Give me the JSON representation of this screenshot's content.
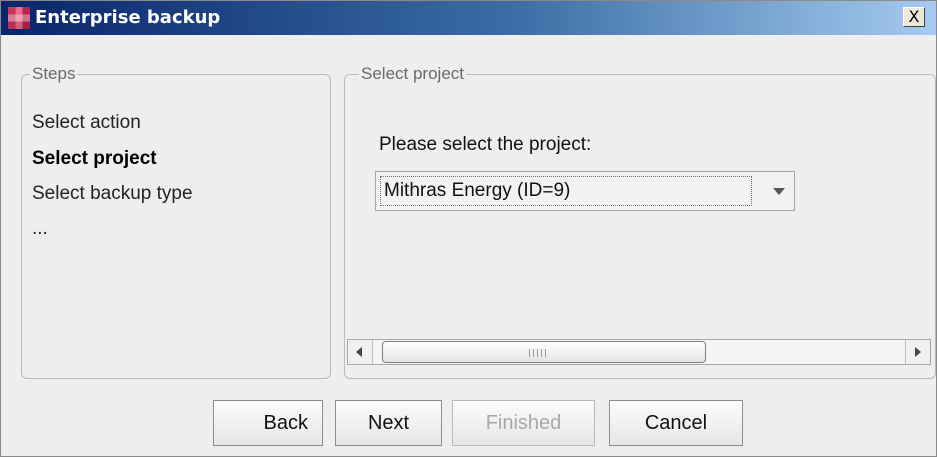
{
  "window": {
    "title": "Enterprise backup",
    "close_label": "X"
  },
  "steps": {
    "legend": "Steps",
    "items": [
      {
        "label": "Select action",
        "active": false
      },
      {
        "label": "Select project",
        "active": true
      },
      {
        "label": "Select backup type",
        "active": false
      },
      {
        "label": "...",
        "active": false
      }
    ]
  },
  "project": {
    "legend": "Select project",
    "prompt": "Please select the project:",
    "selected_value": "Mithras Energy (ID=9)"
  },
  "buttons": {
    "back": "Back",
    "next": "Next",
    "finished": "Finished",
    "cancel": "Cancel"
  }
}
